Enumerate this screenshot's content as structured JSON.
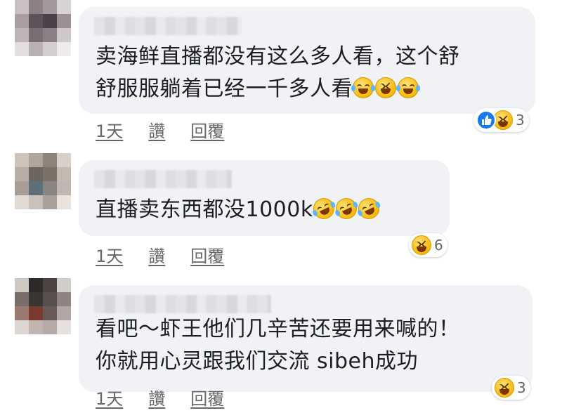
{
  "colors": {
    "bubble_bg": "#f0f2f5",
    "text": "#1c1e21",
    "secondary": "#65676b",
    "like_blue": "#1877f2"
  },
  "comments": [
    {
      "author": "",
      "text_line1": "卖海鲜直播都没有这么多人看，这个舒",
      "text_line2": "舒服服躺着已经一千多人看",
      "emojis": [
        "joy-emoji",
        "laughing-emoji",
        "joy-emoji"
      ],
      "reactions": [
        "like-icon",
        "laughing-icon"
      ],
      "reaction_count": "3",
      "time": "1天",
      "like_label": "讚",
      "reply_label": "回覆"
    },
    {
      "author": "",
      "text_line1": "直播卖东西都没1000k",
      "emojis": [
        "rofl-emoji",
        "rofl-emoji",
        "rofl-emoji"
      ],
      "reactions": [
        "laughing-icon"
      ],
      "reaction_count": "6",
      "time": "1天",
      "like_label": "讚",
      "reply_label": "回覆"
    },
    {
      "author": "",
      "text_line1": "看吧～虾王他们几辛苦还要用来喊的！",
      "text_line2": "你就用心灵跟我们交流 sibeh成功",
      "reactions": [
        "laughing-icon"
      ],
      "reaction_count": "3",
      "time": "1天",
      "like_label": "讚",
      "reply_label": "回覆"
    }
  ]
}
